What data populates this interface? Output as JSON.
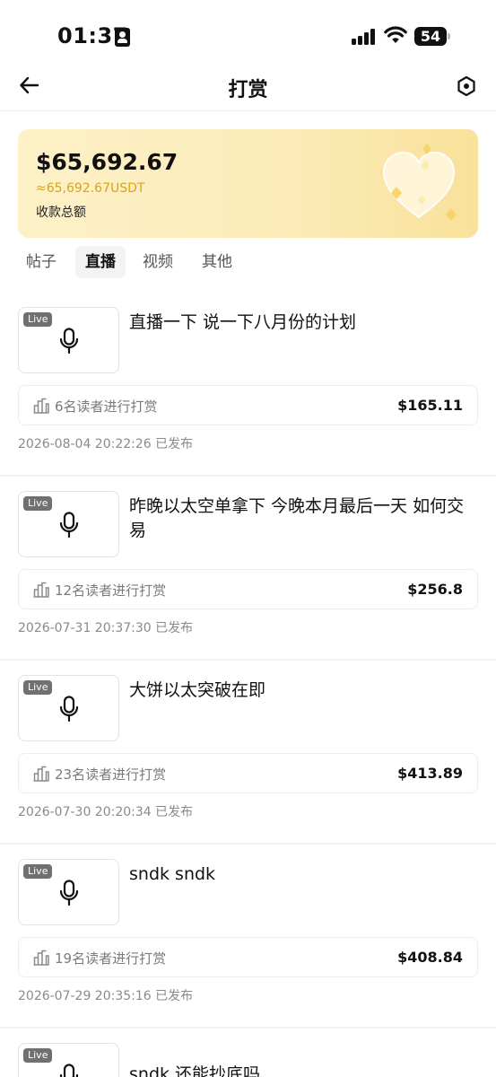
{
  "status": {
    "time": "01:37",
    "battery": "54"
  },
  "nav": {
    "title": "打赏",
    "back_icon": "arrow-left-icon",
    "settings_icon": "hexagon-settings-icon"
  },
  "summary": {
    "total": "$65,692.67",
    "usdt": "≈65,692.67USDT",
    "label": "收款总额",
    "colors": {
      "card_bg": "#fcebb7",
      "usdt_text": "#d8a418"
    }
  },
  "tabs": [
    {
      "label": "帖子",
      "active": false
    },
    {
      "label": "直播",
      "active": true
    },
    {
      "label": "视频",
      "active": false
    },
    {
      "label": "其他",
      "active": false
    }
  ],
  "items": [
    {
      "badge": "Live",
      "title": "直播一下 说一下八月份的计划",
      "readers": "6名读者进行打赏",
      "amount": "$165.11",
      "date": "2026-08-04 20:22:26 已发布"
    },
    {
      "badge": "Live",
      "title": "昨晚以太空单拿下 今晚本月最后一天 如何交易",
      "readers": "12名读者进行打赏",
      "amount": "$256.8",
      "date": "2026-07-31 20:37:30 已发布"
    },
    {
      "badge": "Live",
      "title": "大饼以太突破在即",
      "readers": "23名读者进行打赏",
      "amount": "$413.89",
      "date": "2026-07-30 20:20:34 已发布"
    },
    {
      "badge": "Live",
      "title": "sndk sndk",
      "readers": "19名读者进行打赏",
      "amount": "$408.84",
      "date": "2026-07-29 20:35:16 已发布"
    },
    {
      "badge": "Live",
      "title": "sndk 还能抄底吗",
      "readers": "",
      "amount": "",
      "date": ""
    }
  ]
}
